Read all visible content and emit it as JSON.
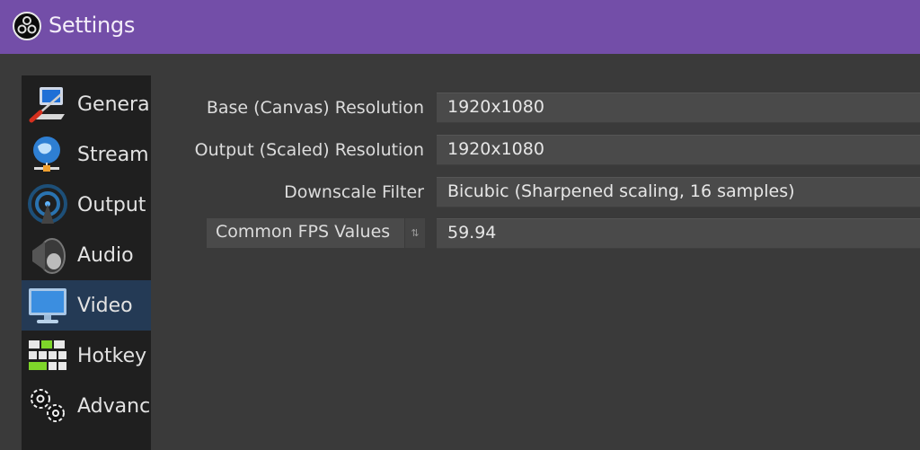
{
  "window": {
    "title": "Settings",
    "logo_icon": "obs-logo-icon",
    "accent_color": "#734ea8"
  },
  "sidebar": {
    "items": [
      {
        "label": "Genera",
        "icon": "general-monitor-wrench-icon",
        "active": false
      },
      {
        "label": "Stream",
        "icon": "stream-globe-icon",
        "active": false
      },
      {
        "label": "Output",
        "icon": "output-antenna-icon",
        "active": false
      },
      {
        "label": "Audio",
        "icon": "audio-speaker-icon",
        "active": false
      },
      {
        "label": "Video",
        "icon": "video-monitor-icon",
        "active": true
      },
      {
        "label": "Hotkey",
        "icon": "hotkeys-keyboard-icon",
        "active": false
      },
      {
        "label": "Advanc",
        "icon": "advanced-gears-icon",
        "active": false
      }
    ]
  },
  "video": {
    "base_resolution": {
      "label": "Base (Canvas) Resolution",
      "value": "1920x1080"
    },
    "output_resolution": {
      "label": "Output (Scaled) Resolution",
      "value": "1920x1080"
    },
    "downscale_filter": {
      "label": "Downscale Filter",
      "value": "Bicubic (Sharpened scaling, 16 samples)"
    },
    "fps": {
      "type_label": "Common FPS Values",
      "value": "59.94"
    }
  }
}
